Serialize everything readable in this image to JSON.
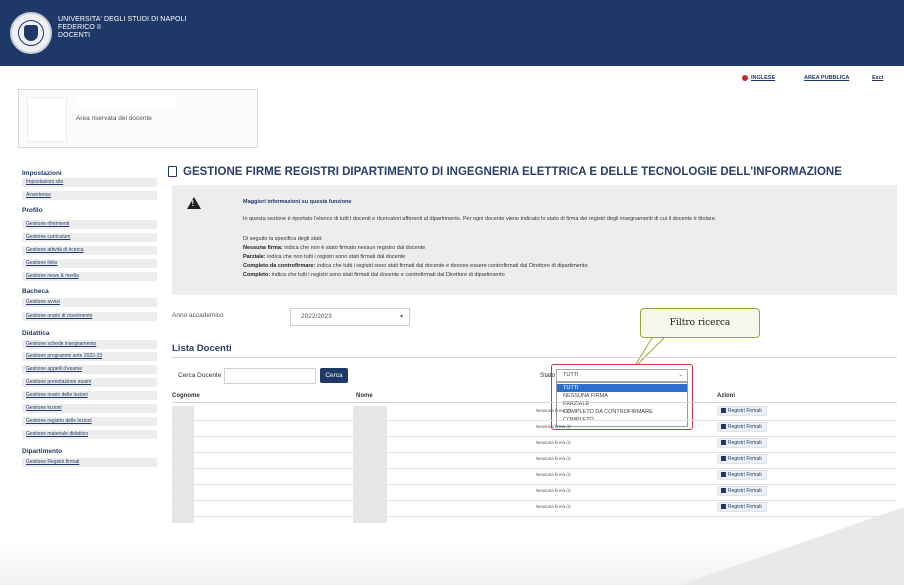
{
  "header": {
    "line1": "UNIVERSITA' DEGLI STUDI DI NAPOLI",
    "line2": "FEDERICO II",
    "line3": "DOCENTI"
  },
  "toplinks": {
    "inglese": "INGLESE",
    "area_pubblica": "AREA PUBBLICA",
    "esci": "Esci"
  },
  "card": {
    "area": "Area riservata del docente"
  },
  "sidebar": {
    "sections": [
      {
        "title": "Impostazioni",
        "items": [
          "Impostazioni sito",
          "Avvertenze"
        ]
      },
      {
        "title": "Profilo",
        "items": [
          "Gestione riferimenti",
          "Gestione curriculum",
          "Gestione attività di ricerca",
          "Gestione links",
          "Gestione news & media"
        ]
      },
      {
        "title": "Bacheca",
        "items": [
          "Gestione avvisi",
          "Gestione orario di ricevimento"
        ]
      },
      {
        "title": "Didattica",
        "items": [
          "Gestione schede insegnamento",
          "Gestione programmi ante 2022-23",
          "Gestione appelli d'esame",
          "Gestione prenotazione esami",
          "Gestione orario delle lezioni",
          "Gestione lezioni",
          "Gestione registro delle lezioni",
          "Gestione materiale didattico"
        ]
      },
      {
        "title": "Dipartimento",
        "items": [
          "Gestione Registri firmati"
        ]
      }
    ]
  },
  "main": {
    "title": "GESTIONE FIRME REGISTRI DIPARTIMENTO DI INGEGNERIA ELETTRICA E DELLE TECNOLOGIE DELL'INFORMAZIONE",
    "info": {
      "heading": "Maggiori informazioni su questa funzione",
      "intro": "In questa sezione è riportato l'elenco di tutti i docenti e ricercatori afferenti al dipartimento. Per ogni docente viene indicato lo stato di firma dei registri degli insegnamenti di cui il docente è titolare.",
      "spec": "Di seguito la specifica degli stati:",
      "states": [
        {
          "name": "Nessuna firma:",
          "desc": " indica che non è stato firmato nessun registro dal docente"
        },
        {
          "name": "Parziale:",
          "desc": " indica che non tutti i registri sono stati firmati dal docente"
        },
        {
          "name": "Completo da controfirmare:",
          "desc": " indica che tutti i registri sono stati firmati dal docente e devono essere controfirmati dal Direttore di dipartimento"
        },
        {
          "name": "Completo:",
          "desc": " indica che tutti i registri sono stati firmati dal docente e controfirmati dal Direttore di dipartimento"
        }
      ]
    },
    "anno_label": "Anno accademico",
    "anno_value": "2022/2023",
    "callout": "Filtro ricerca",
    "lista_title": "Lista Docenti",
    "cerca_label": "Cerca Docente",
    "cerca_placeholder": "",
    "cerca_button": "Cerca",
    "stato_label": "Stato",
    "stato_value": "TUTTI",
    "stato_options": [
      "TUTTI",
      "NESSUNA FIRMA",
      "PARZIALE",
      "COMPLETO DA CONTROFIRMARE",
      "COMPLETO"
    ],
    "table": {
      "headers": {
        "cognome": "Cognome",
        "nome": "Nome",
        "azioni": "Azioni"
      },
      "rows": [
        {
          "stato": "Nessuna firma (!)",
          "azione": "Registri Firmati"
        },
        {
          "stato": "Nessuna firma (!)",
          "azione": "Registri Firmati"
        },
        {
          "stato": "Nessuna firma (!)",
          "azione": "Registri Firmati"
        },
        {
          "stato": "Nessuna firma (!)",
          "azione": "Registri Firmati"
        },
        {
          "stato": "Nessuna firma (!)",
          "azione": "Registri Firmati"
        },
        {
          "stato": "Nessuna firma (!)",
          "azione": "Registri Firmati"
        },
        {
          "stato": "Nessuna firma (!)",
          "azione": "Registri Firmati"
        }
      ]
    }
  }
}
